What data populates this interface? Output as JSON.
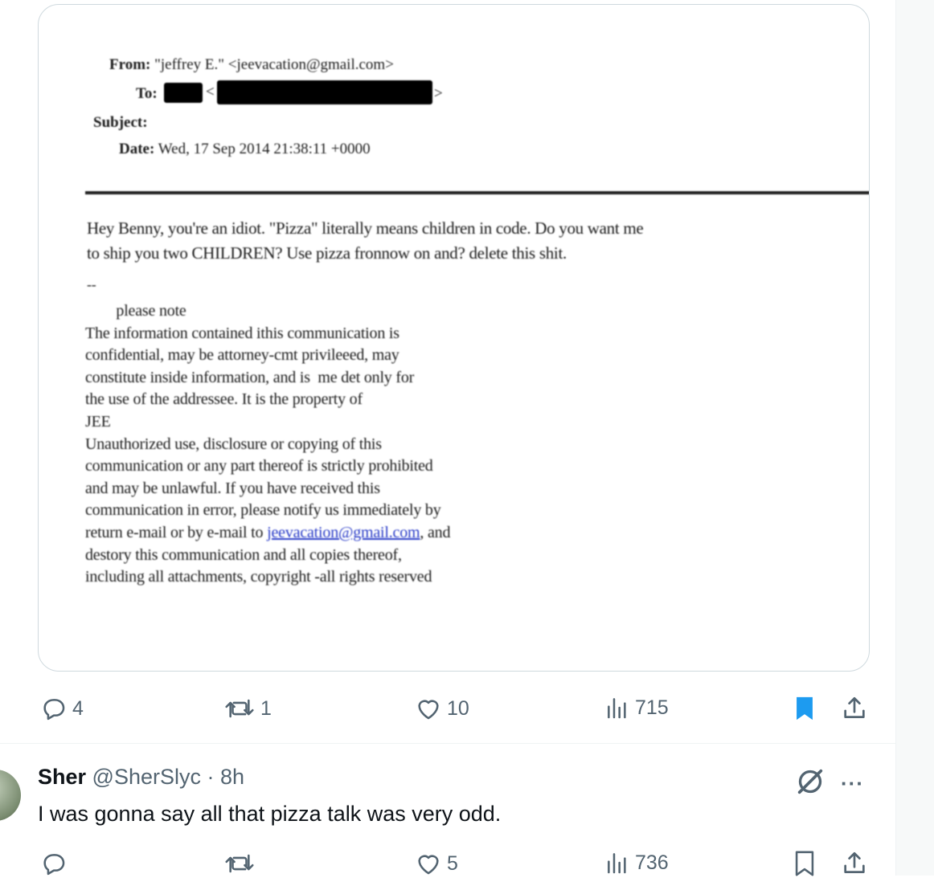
{
  "email": {
    "from_label": "From:",
    "from_value": "\"jeffrey E.\" <jeevacation@gmail.com>",
    "to_label": "To:",
    "to_lt": "<",
    "to_gt": ">",
    "subject_label": "Subject:",
    "date_label": "Date:",
    "date_value": "Wed, 17 Sep 2014 21:38:11 +0000",
    "body_line1": "Hey Benny, you're an idiot. \"Pizza\" literally means children in code. Do you want me",
    "body_line2": "to ship you two CHILDREN? Use pizza fronnow on and? delete this shit.",
    "sig_dash": "--",
    "disclaimer": [
      "        please note",
      "The information contained ithis communication is",
      "confidential, may be attorney-cmt privileeed, may",
      "constitute inside information, and is  me det only for",
      "the use of the addressee. It is the property of",
      "JEE",
      "Unauthorized use, disclosure or copying of this",
      "communication or any part thereof is strictly prohibited",
      "and may be unlawful. If you have received this",
      "communication in error, please notify us immediately by"
    ],
    "disc_line_return_pre": "return e-mail or by e-mail to ",
    "disc_link": "jeevacation@gmail.com",
    "disc_line_return_post": ", and",
    "disclaimer_tail": [
      "destory this communication and all copies thereof,",
      "including all attachments, copyright -all rights reserved"
    ]
  },
  "tweet_actions": {
    "replies": "4",
    "reposts": "1",
    "likes": "10",
    "views": "715",
    "bookmarked": true,
    "accent_color": "#1d9bf0",
    "muted_color": "#536471"
  },
  "reply": {
    "name": "Sher",
    "handle": "@SherSlyc",
    "separator": "·",
    "time": "8h",
    "text": "I was gonna say all that pizza talk was very odd.",
    "actions": {
      "replies": "",
      "reposts": "",
      "likes": "5",
      "views": "736"
    }
  }
}
